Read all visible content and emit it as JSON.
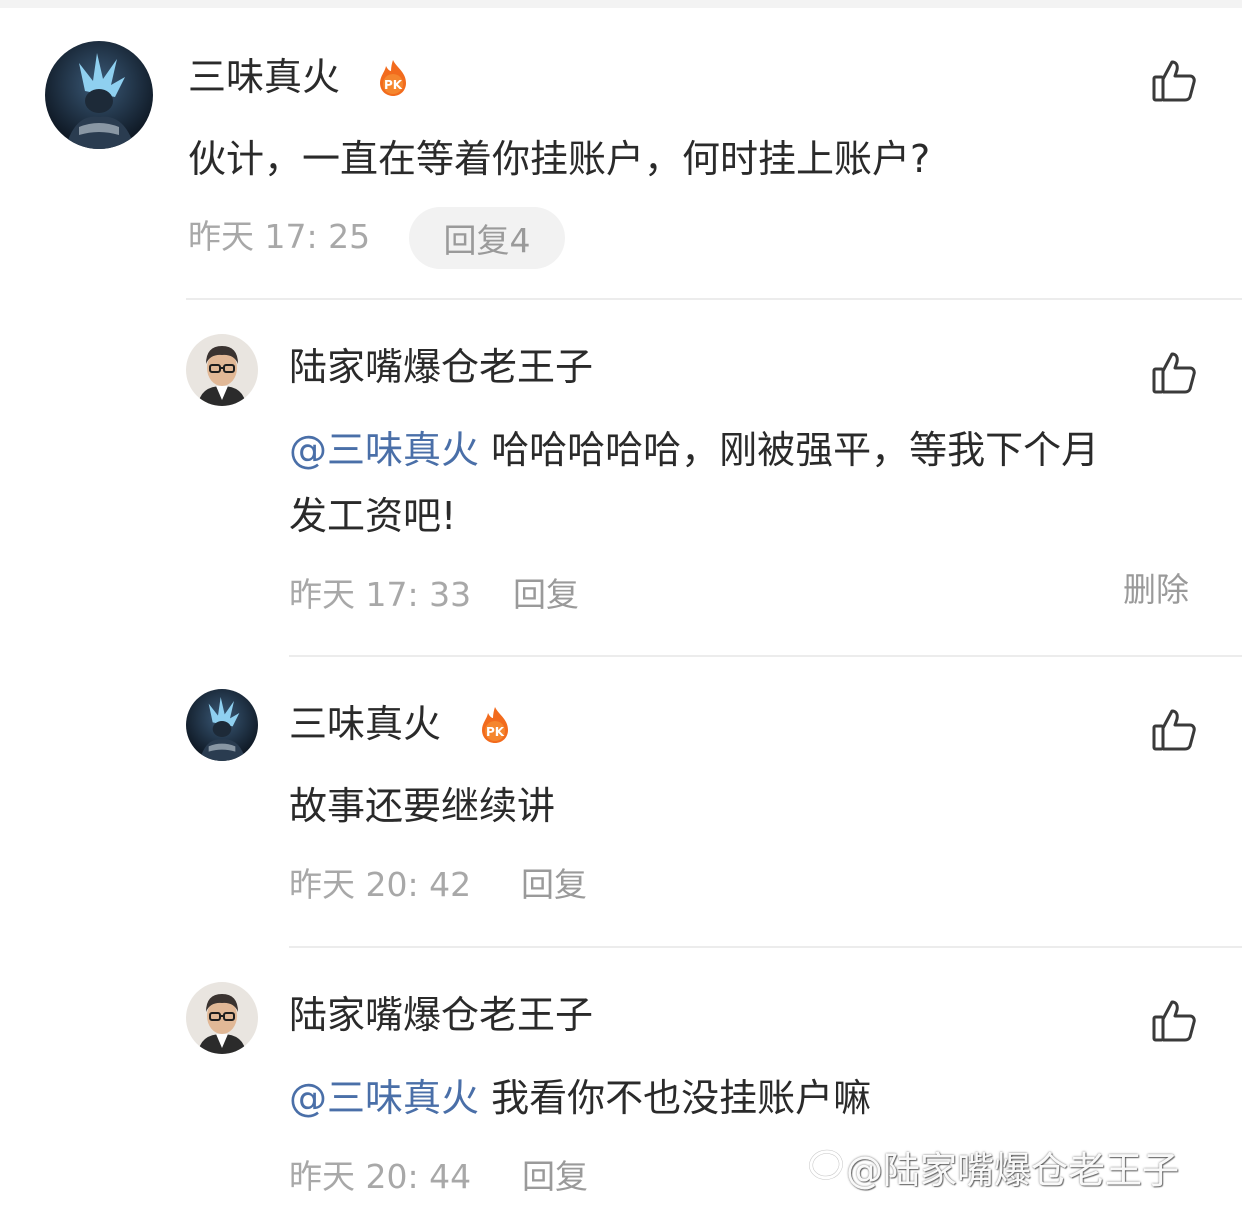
{
  "comments": [
    {
      "user": "三味真火",
      "badge": "PK",
      "text": "伙计，一直在等着你挂账户，何时挂上账户?",
      "time": "昨天 17: 25",
      "reply_label": "回复4"
    }
  ],
  "replies": [
    {
      "user": "陆家嘴爆仓老王子",
      "mention": "@三味真火",
      "text_line1": " 哈哈哈哈哈，刚被强平，等我下个月",
      "text_line2": "发工资吧!",
      "time": "昨天 17: 33",
      "reply_label": "回复",
      "delete_label": "删除"
    },
    {
      "user": "三味真火",
      "badge": "PK",
      "text": "故事还要继续讲",
      "time": "昨天 20: 42",
      "reply_label": "回复"
    },
    {
      "user": "陆家嘴爆仓老王子",
      "mention": "@三味真火",
      "text": " 我看你不也没挂账户嘛",
      "time": "昨天 20: 44",
      "reply_label": "回复"
    }
  ],
  "watermark": "@陆家嘴爆仓老王子",
  "icons": {
    "like": "thumbs-up-icon",
    "badge": "pk-flame-badge-icon",
    "watermark": "weibo-logo-icon"
  },
  "colors": {
    "mention": "#4a6fa8",
    "badge": "#f26b1d",
    "muted": "#a8a8a8"
  }
}
